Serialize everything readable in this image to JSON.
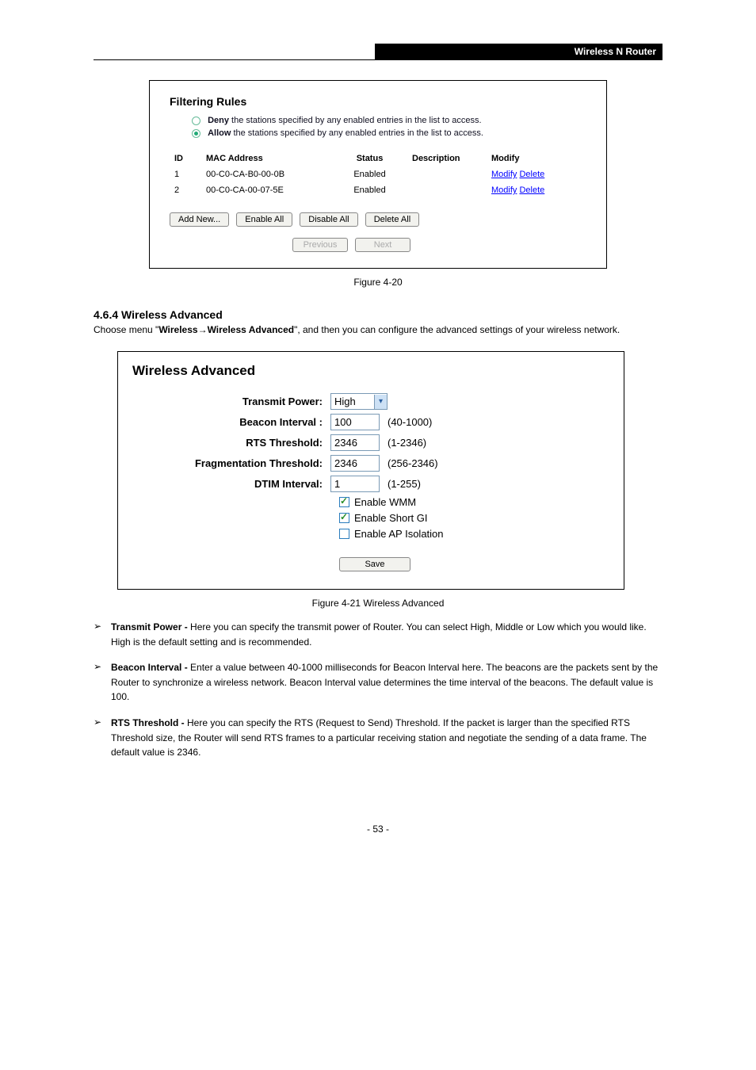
{
  "header": {
    "right": "Wireless N Router"
  },
  "filter_panel": {
    "title": "Filtering Rules",
    "deny_label_strong": "Deny",
    "deny_label_rest": " the stations specified by any enabled entries in the list to access.",
    "allow_label_strong": "Allow",
    "allow_label_rest": " the stations specified by any enabled entries in the list to access.",
    "headers": {
      "id": "ID",
      "mac": "MAC Address",
      "status": "Status",
      "desc": "Description",
      "modify": "Modify"
    },
    "rows": [
      {
        "id": "1",
        "mac": "00-C0-CA-B0-00-0B",
        "status": "Enabled",
        "modify": "Modify",
        "delete": "Delete"
      },
      {
        "id": "2",
        "mac": "00-C0-CA-00-07-5E",
        "status": "Enabled",
        "modify": "Modify",
        "delete": "Delete"
      }
    ],
    "buttons": {
      "add": "Add New...",
      "enable_all": "Enable All",
      "disable_all": "Disable All",
      "delete_all": "Delete All",
      "prev": "Previous",
      "next": "Next"
    }
  },
  "fig_caption": "Figure 4-20",
  "section_heading": "4.6.4 Wireless Advanced",
  "section_text_pre": "Choose menu \"",
  "section_text_bold1": "Wireless",
  "section_text_arrow": " → ",
  "section_text_bold2": "Wireless Advanced",
  "section_text_post": "\", and then you can configure the advanced settings of your wireless network.",
  "wa": {
    "title": "Wireless Advanced",
    "labels": {
      "tp": "Transmit Power:",
      "bi": "Beacon Interval :",
      "rts": "RTS Threshold:",
      "ft": "Fragmentation Threshold:",
      "dtim": "DTIM Interval:"
    },
    "values": {
      "tp": "High",
      "bi": "100",
      "rts": "2346",
      "ft": "2346",
      "dtim": "1"
    },
    "hints": {
      "bi": "(40-1000)",
      "rts": "(1-2346)",
      "ft": "(256-2346)",
      "dtim": "(1-255)"
    },
    "cb_wmm": "Enable WMM",
    "cb_sgi": "Enable Short GI",
    "cb_api": "Enable AP Isolation",
    "save": "Save"
  },
  "wa_caption": "Figure 4-21 Wireless Advanced",
  "bullets": [
    {
      "strong": "Transmit Power - ",
      "rest": "Here you can specify the transmit power of Router. You can select High, Middle or Low which you would like. High is the default setting and is recommended."
    },
    {
      "strong": "Beacon Interval - ",
      "rest": "Enter a value between 40-1000 milliseconds for Beacon Interval here. The beacons are the packets sent by the Router to synchronize a wireless network. Beacon Interval value determines the time interval of the beacons. The default value is 100."
    },
    {
      "strong": "RTS Threshold - ",
      "rest": "Here you can specify the RTS (Request to Send) Threshold. If the packet is larger than the specified RTS Threshold size, the Router will send RTS frames to a particular receiving station and negotiate the sending of a data frame. The default value is 2346."
    }
  ],
  "page_number": "- 53 -"
}
